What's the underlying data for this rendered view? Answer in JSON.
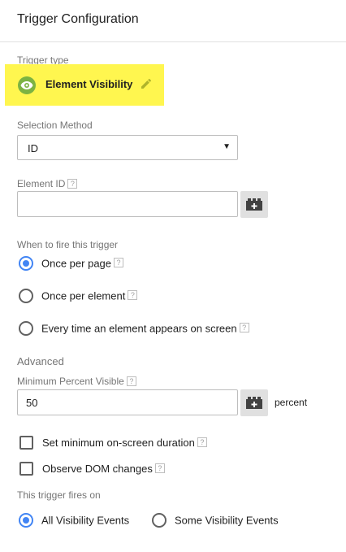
{
  "header": {
    "title": "Trigger Configuration"
  },
  "trigger_type": {
    "label": "Trigger type",
    "value": "Element Visibility",
    "icon": "eye-icon",
    "highlight_color": "#fff64f",
    "icon_color": "#7cb342"
  },
  "selection_method": {
    "label": "Selection Method",
    "value": "ID"
  },
  "element_id": {
    "label": "Element ID",
    "value": ""
  },
  "fire_when": {
    "label": "When to fire this trigger",
    "options": [
      {
        "label": "Once per page",
        "checked": true
      },
      {
        "label": "Once per element",
        "checked": false
      },
      {
        "label": "Every time an element appears on screen",
        "checked": false
      }
    ]
  },
  "advanced": {
    "title": "Advanced",
    "min_percent": {
      "label": "Minimum Percent Visible",
      "value": "50",
      "unit": "percent"
    },
    "checkboxes": [
      {
        "label": "Set minimum on-screen duration",
        "checked": false
      },
      {
        "label": "Observe DOM changes",
        "checked": false
      }
    ]
  },
  "fires_on": {
    "label": "This trigger fires on",
    "options": [
      {
        "label": "All Visibility Events",
        "checked": true
      },
      {
        "label": "Some Visibility Events",
        "checked": false
      }
    ]
  },
  "help_glyph": "?",
  "accent_color": "#4285f4"
}
